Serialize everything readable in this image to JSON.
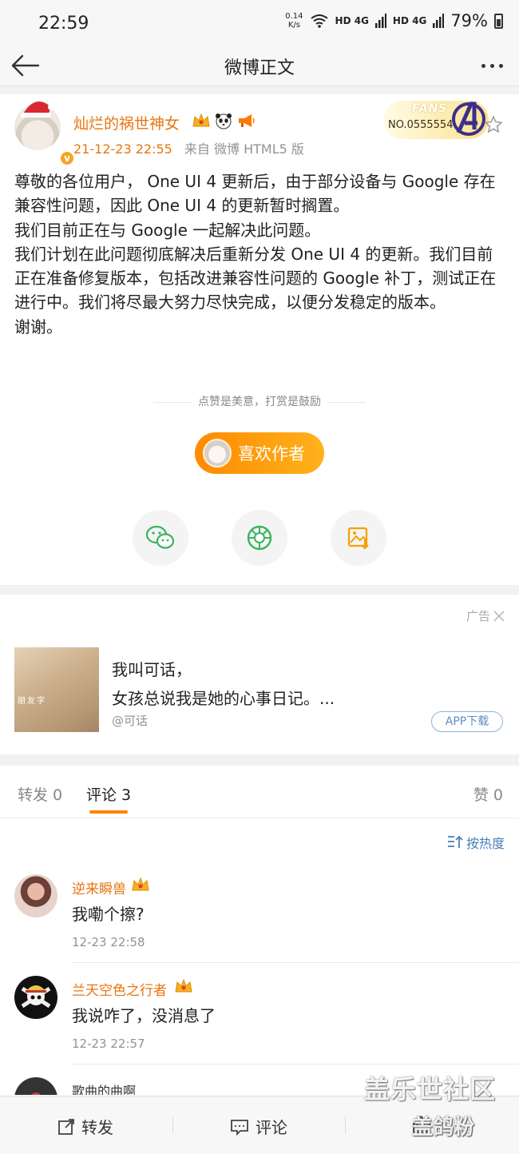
{
  "status_bar": {
    "time": "22:59",
    "speed_value": "0.14",
    "speed_unit": "K/s",
    "net1": "HD 4G",
    "net2": "HD 4G",
    "battery": "79%"
  },
  "nav": {
    "title": "微博正文"
  },
  "post": {
    "author": "灿烂的祸世神女",
    "time": "21-12-23 22:55",
    "source": "来自 微博 HTML5 版",
    "fans_label": "FANS",
    "fans_no": "NO.0555554",
    "body": [
      "尊敬的各位用户， One UI 4 更新后，由于部分设备与 Google 存在兼容性问题，因此 One UI 4 的更新暂时搁置。",
      "我们目前正在与 Google 一起解决此问题。",
      "我们计划在此问题彻底解决后重新分发 One UI 4 的更新。我们目前正在准备修复版本，包括改进兼容性问题的 Google 补丁，测试正在进行中。我们将尽最大努力尽快完成，以便分发稳定的版本。",
      "谢谢。"
    ],
    "reward_tip": "点赞是美意，打赏是鼓励",
    "like_author": "喜欢作者"
  },
  "ad": {
    "tag": "广告",
    "line1": "我叫可话，",
    "line2": "女孩总说我是她的心事日记。...",
    "image_text": "朋友字",
    "source": "@可话",
    "button": "APP下载"
  },
  "tabs": {
    "repost": "转发 0",
    "comment": "评论 3",
    "like": "赞 0"
  },
  "sort_label": "按热度",
  "comments": [
    {
      "name": "逆来瞬兽",
      "text": "我嘞个擦?",
      "time": "12-23 22:58"
    },
    {
      "name": "兰天空色之行者",
      "text": "我说咋了，没消息了",
      "time": "12-23 22:57"
    },
    {
      "name": "歌曲的曲啊",
      "text": "",
      "time": ""
    }
  ],
  "bottom_bar": {
    "repost": "转发",
    "comment": "评论"
  },
  "watermark": {
    "line1": "盖乐世社区",
    "line2": "盖鸽粉"
  },
  "colors": {
    "accent": "#ff8200",
    "name": "#e8750f",
    "link": "#4a7fb8",
    "wechat": "#3cb35d"
  }
}
